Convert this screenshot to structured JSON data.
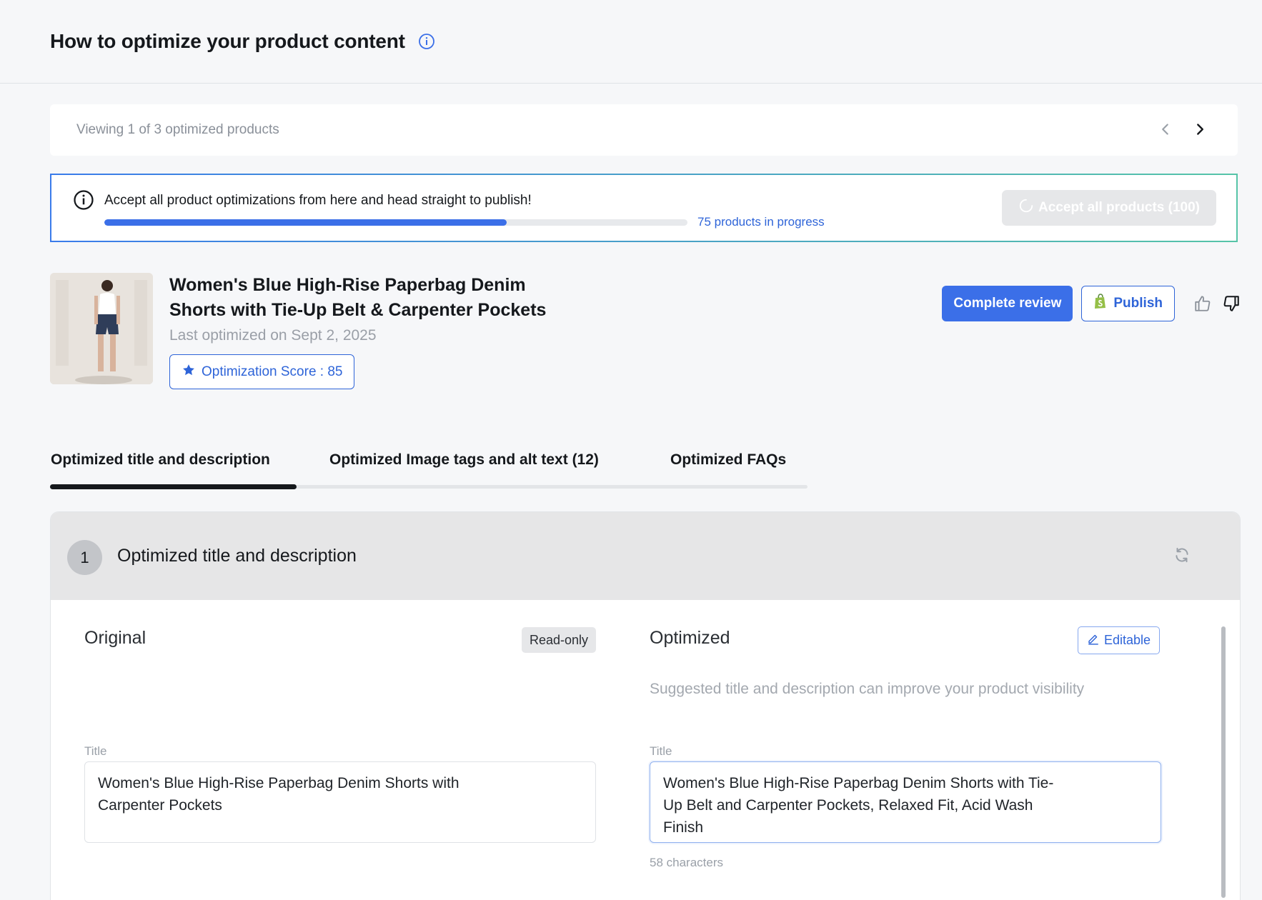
{
  "header": {
    "title": "How to optimize your product content",
    "icon": "info-icon"
  },
  "viewer": {
    "text": "Viewing 1 of 3 optimized products",
    "prev_icon": "chevron-left-icon",
    "next_icon": "chevron-right-icon"
  },
  "banner": {
    "text": "Accept all product optimizations from here and head straight to publish!",
    "progress_fraction": 0.69,
    "progress_label": "75 products in progress",
    "accept_all_label": "Accept all products (100)"
  },
  "product": {
    "title": "Women's Blue High-Rise Paperbag Denim Shorts with Tie-Up Belt & Carpenter Pockets",
    "last_optimized": "Last optimized on Sept 2, 2025",
    "score_label": "Optimization Score : 85",
    "complete_review_label": "Complete review",
    "publish_label": "Publish"
  },
  "tabs": [
    {
      "label": "Optimized title and description",
      "active": true
    },
    {
      "label": "Optimized Image tags and alt text (12)",
      "active": false
    },
    {
      "label": "Optimized FAQs",
      "active": false
    }
  ],
  "section": {
    "step": "1",
    "title": "Optimized title and description",
    "original": {
      "heading": "Original",
      "badge": "Read-only",
      "field_label": "Title",
      "value": "Women's Blue High-Rise Paperbag Denim Shorts with Carpenter Pockets"
    },
    "optimized": {
      "heading": "Optimized",
      "badge": "Editable",
      "hint": "Suggested title and description can improve your product visibility",
      "field_label": "Title",
      "value": "Women's Blue High-Rise Paperbag Denim Shorts with Tie-Up Belt and Carpenter Pockets, Relaxed Fit, Acid Wash Finish",
      "char_count": "58 characters"
    }
  },
  "colors": {
    "accent": "#3b6fe8",
    "link": "#2e64d8",
    "text": "#15181c"
  }
}
